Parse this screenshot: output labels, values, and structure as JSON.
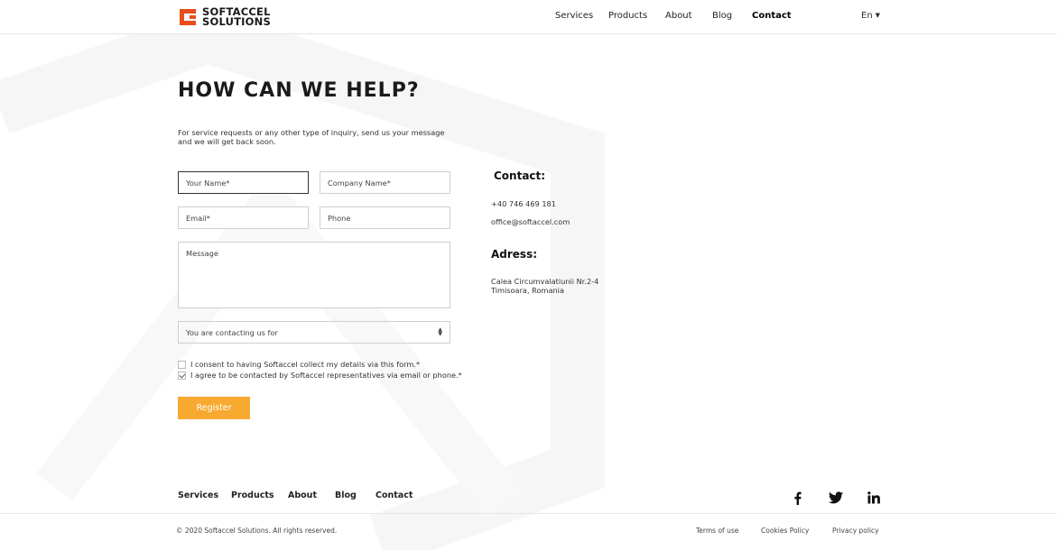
{
  "brand": {
    "logo_line1": "SOFTACCEL",
    "logo_line2": "SOLUTIONS",
    "accent_color": "#e84e1b",
    "button_color": "#f7a930"
  },
  "nav": {
    "items": [
      "Services",
      "Products",
      "About",
      "Blog",
      "Contact"
    ],
    "active": "Contact",
    "language": "En"
  },
  "main": {
    "title": "HOW CAN WE HELP?",
    "intro": "For service requests or any other type of inquiry, send us your message and we will get back soon."
  },
  "form": {
    "name_placeholder": "Your Name*",
    "company_placeholder": "Company Name*",
    "email_placeholder": "Email*",
    "phone_placeholder": "Phone",
    "message_placeholder": "Message",
    "select_value": "You are contacting us for",
    "consent_label": "I consent to having Softaccel collect my details via this form.*",
    "consent_checked": false,
    "agree_label": "I agree to be contacted by Softaccel representatives via email or phone.*",
    "agree_checked": true,
    "register_label": "Register"
  },
  "contact": {
    "heading": "Contact:",
    "phone": "+40 746 469 181",
    "email": "office@softaccel.com",
    "address_heading": "Adress:",
    "address_line1": "Calea Circumvalatiunii Nr.2-4",
    "address_line2": "Timisoara, Romania"
  },
  "footer": {
    "nav": [
      "Services",
      "Products",
      "About",
      "Blog",
      "Contact"
    ],
    "social_icons": [
      "facebook-icon",
      "twitter-icon",
      "linkedin-icon"
    ],
    "copyright": "© 2020 Softaccel Solutions. All rights reserved.",
    "legal": [
      "Terms of use",
      "Cookies Policy",
      "Privacy policy"
    ]
  }
}
